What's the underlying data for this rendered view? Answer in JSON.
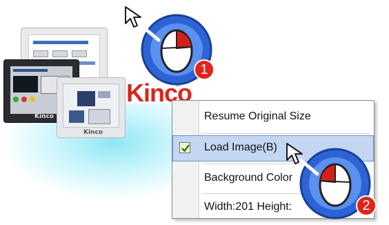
{
  "brand": {
    "logo_text": "Kinco",
    "logo_mark": "®",
    "panel_label": "Kinco",
    "logo_color": "#d9261c"
  },
  "context_menu": {
    "items": [
      {
        "label": "Resume Original Size"
      },
      {
        "label": "Load Image(B)",
        "highlighted": true,
        "checked": true
      },
      {
        "label": "Background Color"
      },
      {
        "label": "Width:201 Height:"
      }
    ],
    "highlight_color": "#c3d7f3"
  },
  "steps": [
    {
      "number": "1",
      "icon": "mouse-click-icon"
    },
    {
      "number": "2",
      "icon": "mouse-click-icon"
    }
  ],
  "colors": {
    "step_badge": "#e2231a",
    "mouse_ring": "#2d63d4"
  }
}
